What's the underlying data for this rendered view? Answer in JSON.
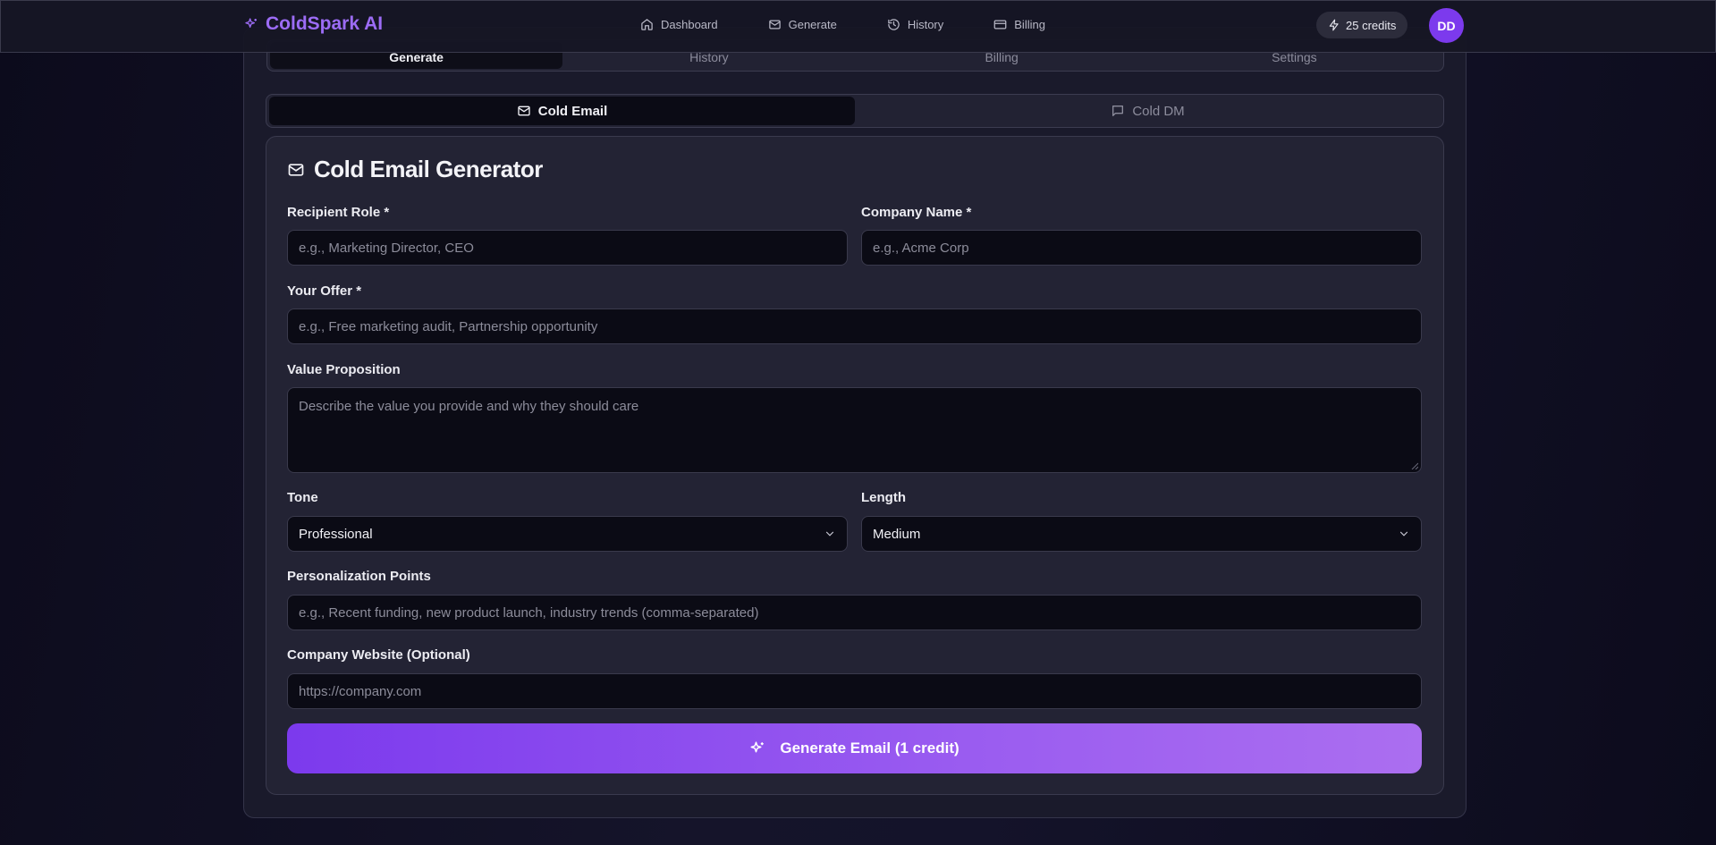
{
  "brand": {
    "name": "ColdSpark AI",
    "icon": "sparkles-icon"
  },
  "nav": [
    {
      "label": "Dashboard",
      "icon": "home-icon"
    },
    {
      "label": "Generate",
      "icon": "mail-icon"
    },
    {
      "label": "History",
      "icon": "history-icon"
    },
    {
      "label": "Billing",
      "icon": "credit-card-icon"
    }
  ],
  "credits": {
    "label": "25 credits",
    "icon": "zap-icon"
  },
  "avatar": {
    "initials": "DD"
  },
  "tabs": [
    "Generate",
    "History",
    "Billing",
    "Settings"
  ],
  "subtabs": [
    {
      "label": "Cold Email",
      "icon": "mail-icon"
    },
    {
      "label": "Cold DM",
      "icon": "message-square-icon"
    }
  ],
  "form": {
    "title": "Cold Email Generator",
    "recipient_role": {
      "label": "Recipient Role *",
      "placeholder": "e.g., Marketing Director, CEO"
    },
    "company_name": {
      "label": "Company Name *",
      "placeholder": "e.g., Acme Corp"
    },
    "offer": {
      "label": "Your Offer *",
      "placeholder": "e.g., Free marketing audit, Partnership opportunity"
    },
    "value_prop": {
      "label": "Value Proposition",
      "placeholder": "Describe the value you provide and why they should care"
    },
    "tone": {
      "label": "Tone",
      "value": "Professional"
    },
    "length": {
      "label": "Length",
      "value": "Medium"
    },
    "personalization": {
      "label": "Personalization Points",
      "placeholder": "e.g., Recent funding, new product launch, industry trends (comma-separated)"
    },
    "website": {
      "label": "Company Website (Optional)",
      "placeholder": "https://company.com"
    },
    "submit_label": "Generate Email (1 credit)"
  },
  "colors": {
    "accent": "#7c3aed",
    "brand_text": "#9c6cf5"
  }
}
